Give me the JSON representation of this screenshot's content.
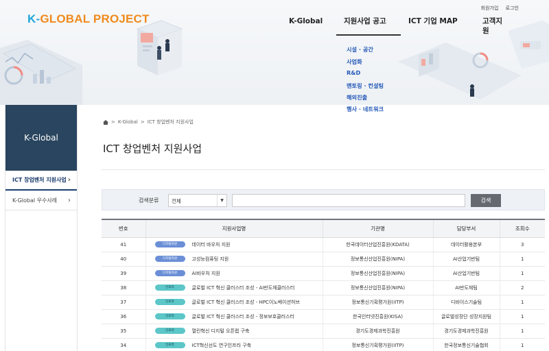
{
  "header": {
    "logo_part1": "K-",
    "logo_part2": "GLOBAL PROJECT",
    "util_links": [
      "회원가입",
      "로그인"
    ],
    "nav": [
      "K-Global",
      "지원사업 공고",
      "ICT 기업 MAP",
      "고객지원"
    ],
    "submenu": [
      "시설 · 공간",
      "사업화",
      "R&D",
      "멘토링 · 컨설팅",
      "해외진출",
      "행사 · 네트워크"
    ]
  },
  "sidebar": {
    "title": "K-Global",
    "items": [
      {
        "label": "ICT 창업벤처 지원사업"
      },
      {
        "label": "K-Global 우수사례"
      }
    ]
  },
  "breadcrumb": [
    "K-Global",
    "ICT 창업벤처 지원사업"
  ],
  "page_title": "ICT 창업벤처 지원사업",
  "search": {
    "label": "검색분류",
    "select_value": "전체",
    "input_value": "",
    "button": "검색"
  },
  "table": {
    "headers": [
      "번호",
      "지원사업명",
      "기관명",
      "담당부서",
      "조회수"
    ],
    "rows": [
      {
        "no": "41",
        "tag": "디지털자원",
        "tag_color": "blue",
        "title": "데이터 바우처 지원",
        "org": "한국데이터산업진흥원(KDATA)",
        "dept": "데이터활용본부",
        "views": "3"
      },
      {
        "no": "40",
        "tag": "디지털자원",
        "tag_color": "blue",
        "title": "고성능컴퓨팅 지원",
        "org": "정보통신산업진흥원(NIPA)",
        "dept": "AI산업기반팀",
        "views": "1"
      },
      {
        "no": "39",
        "tag": "디지털자원",
        "tag_color": "blue",
        "title": "AI바우처 지원",
        "org": "정보통신산업진흥원(NIPA)",
        "dept": "AI산업기반팀",
        "views": "1"
      },
      {
        "no": "38",
        "tag": "인프라",
        "tag_color": "teal",
        "title": "글로벌 ICT 혁신 클러스터 조성 - AI반도체클러스터",
        "org": "정보통신산업진흥원(NIPA)",
        "dept": "AI반도체팀",
        "views": "2"
      },
      {
        "no": "37",
        "tag": "인프라",
        "tag_color": "teal",
        "title": "글로벌 ICT 혁신 클러스터 조성 - HPC이노베이션허브",
        "org": "정보통신기획평가원(IITP)",
        "dept": "디바이스기술팀",
        "views": "1"
      },
      {
        "no": "36",
        "tag": "인프라",
        "tag_color": "teal",
        "title": "글로벌 ICT 혁신 클러스터 조성 - 정보보호클러스터",
        "org": "한국인터넷진흥원(KISA)",
        "dept": "글로벌성장단 성장지원팀",
        "views": "1"
      },
      {
        "no": "35",
        "tag": "인프라",
        "tag_color": "teal",
        "title": "열린혁신 디지털 오픈랩 구축",
        "org": "경기도경제과학진흥원",
        "dept": "경기도경제과학진흥원",
        "views": "1"
      },
      {
        "no": "34",
        "tag": "인프라",
        "tag_color": "teal",
        "title": "ICT혁신선도 연구인프라 구축",
        "org": "정보통신기획평가원(IITP)",
        "dept": "한국정보통신기술협회",
        "views": "1"
      }
    ]
  },
  "colors": {
    "sidebar_bg": "#29455f",
    "tag_blue": "#6b8fd6",
    "tag_teal": "#5cc6c8",
    "submenu_text": "#2458b8",
    "logo_k": "#1fa6d9",
    "logo_text": "#f08a1c"
  }
}
